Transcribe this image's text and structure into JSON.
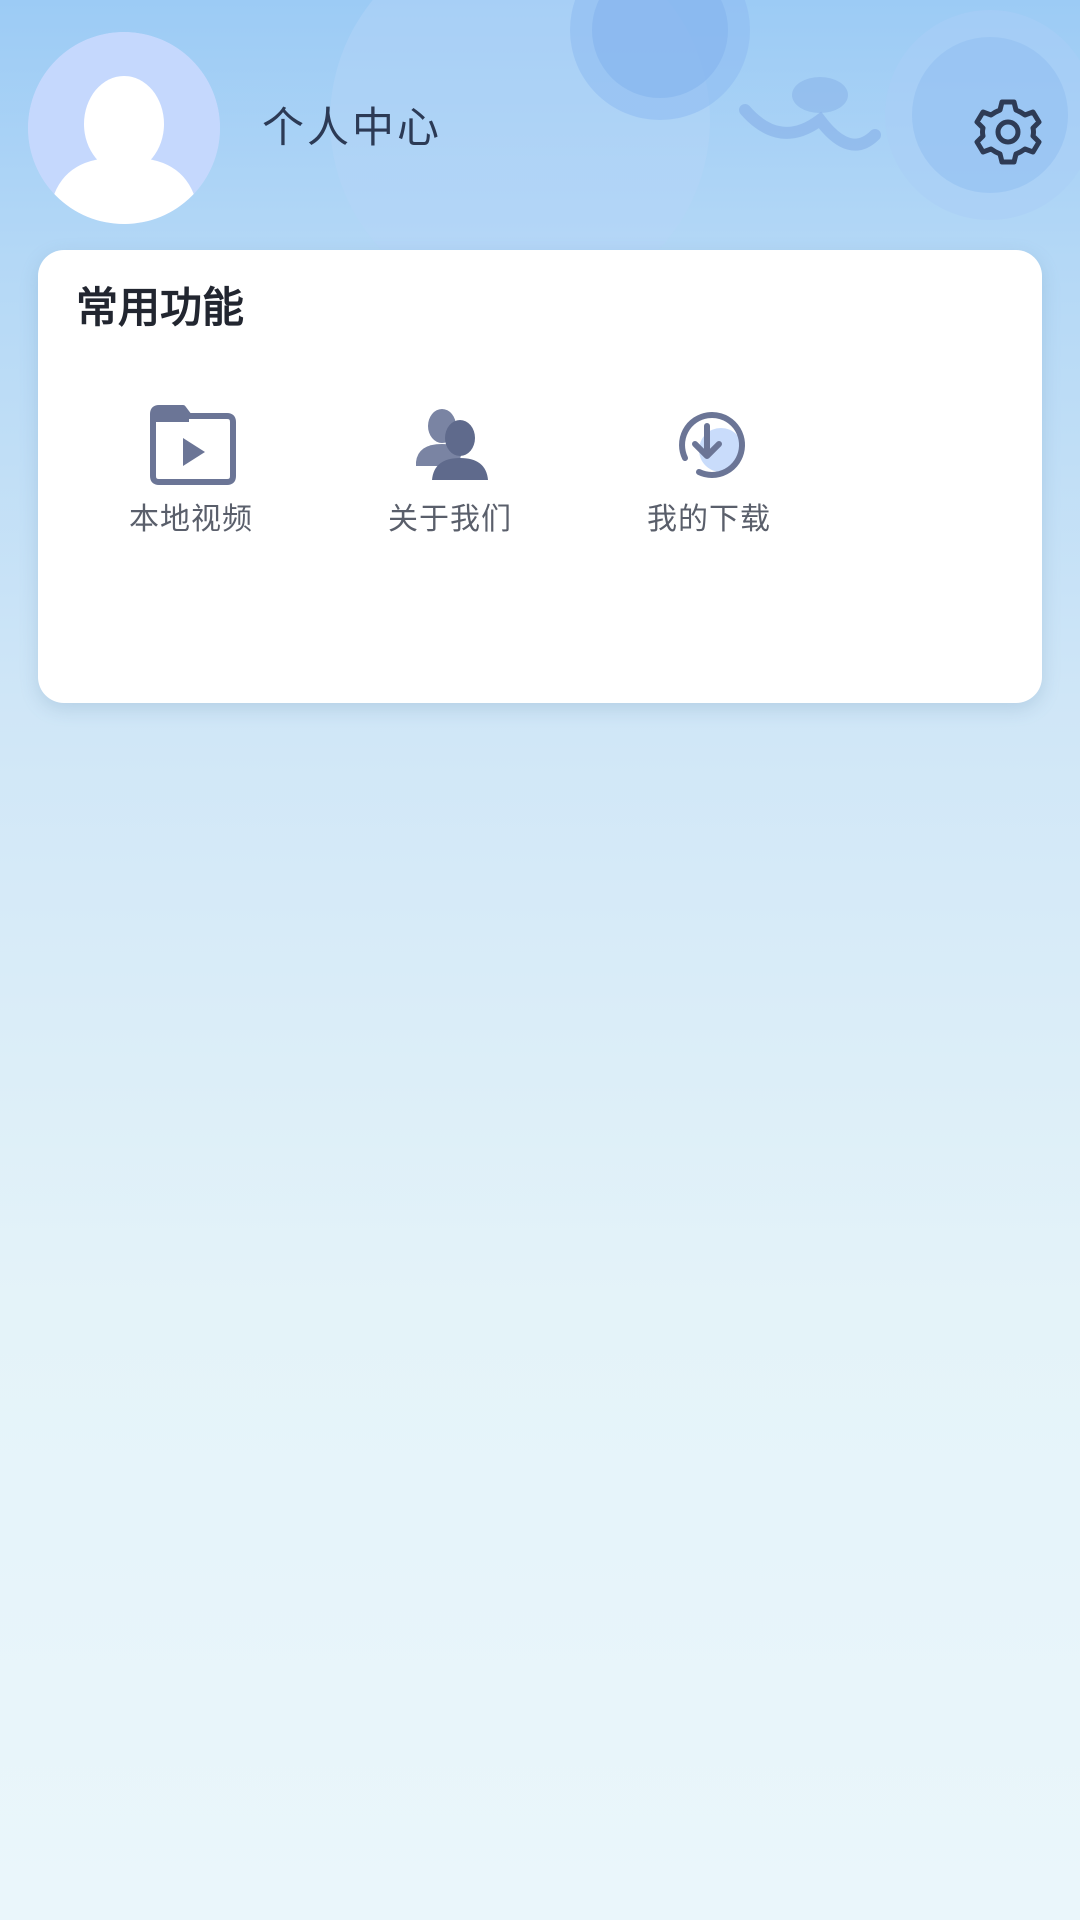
{
  "header": {
    "title": "个人中心",
    "avatar_icon": "default-user-avatar-icon",
    "settings_icon": "gear-icon"
  },
  "card": {
    "title": "常用功能",
    "items": [
      {
        "label": "本地视频",
        "icon": "video-folder-icon"
      },
      {
        "label": "关于我们",
        "icon": "users-icon"
      },
      {
        "label": "我的下载",
        "icon": "download-circle-icon"
      }
    ]
  },
  "colors": {
    "accent_icon": "#6b7596",
    "avatar_bg": "#c5d8fd",
    "title_text": "#2c3a55"
  }
}
